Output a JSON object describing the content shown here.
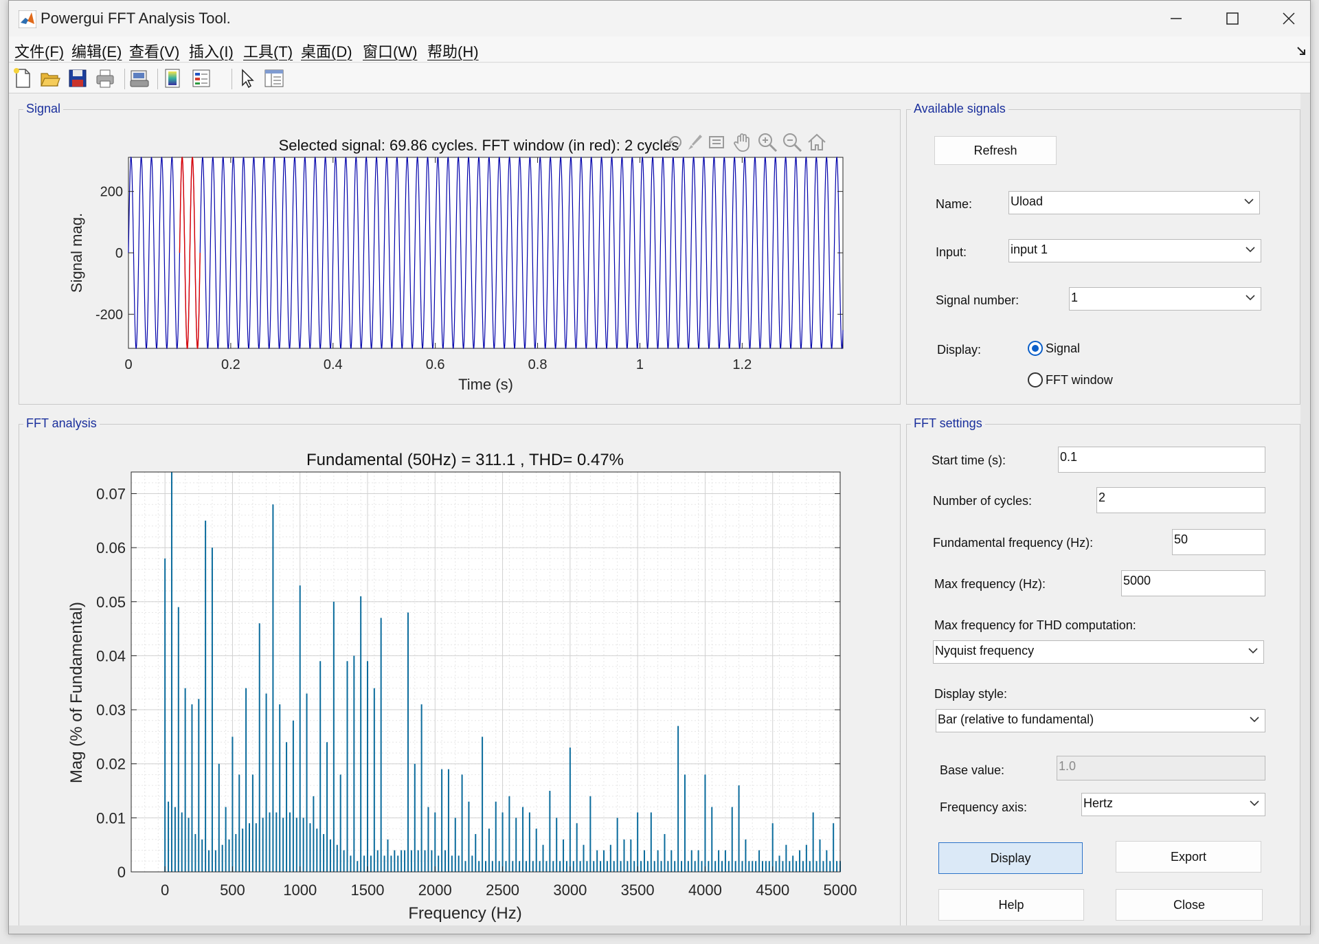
{
  "window": {
    "title": "Powergui FFT Analysis Tool."
  },
  "menu": [
    "文件(F)",
    "编辑(E)",
    "查看(V)",
    "插入(I)",
    "工具(T)",
    "桌面(D)",
    "窗口(W)",
    "帮助(H)"
  ],
  "toolbar_icons": [
    "new-file-icon",
    "open-folder-icon",
    "save-icon",
    "print-icon",
    "print-preview-icon",
    "colorbar-icon",
    "legend-icon",
    "select-pointer-icon",
    "property-inspector-icon"
  ],
  "signal_panel": {
    "title": "Signal",
    "axes_toolbar_icons": [
      "restore-view-icon",
      "data-tips-icon",
      "brush-icon",
      "pan-icon",
      "zoom-in-icon",
      "zoom-out-icon",
      "home-icon"
    ]
  },
  "fft_panel": {
    "title": "FFT analysis"
  },
  "available_signals": {
    "title": "Available signals",
    "refresh_label": "Refresh",
    "name_label": "Name:",
    "name_value": "Uload",
    "input_label": "Input:",
    "input_value": "input 1",
    "signal_number_label": "Signal number:",
    "signal_number_value": "1",
    "display_label": "Display:",
    "display_options": [
      "Signal",
      "FFT window"
    ],
    "display_selected": "Signal"
  },
  "fft_settings": {
    "title": "FFT settings",
    "start_time_label": "Start time (s):",
    "start_time_value": "0.1",
    "num_cycles_label": "Number of cycles:",
    "num_cycles_value": "2",
    "fund_freq_label": "Fundamental frequency (Hz):",
    "fund_freq_value": "50",
    "max_freq_label": "Max frequency (Hz):",
    "max_freq_value": "5000",
    "thd_label": "Max frequency for THD computation:",
    "thd_value": "Nyquist frequency",
    "display_style_label": "Display style:",
    "display_style_value": "Bar (relative to fundamental)",
    "base_value_label": "Base value:",
    "base_value_value": "1.0",
    "freq_axis_label": "Frequency axis:",
    "freq_axis_value": "Hertz",
    "buttons": {
      "display": "Display",
      "export": "Export",
      "help": "Help",
      "close": "Close"
    }
  },
  "colors": {
    "signal_line": "#0000aa",
    "fft_window_line": "#dd0000",
    "bar_color": "#0a6b9c",
    "panel_title": "#1a2f9c"
  },
  "chart_data": [
    {
      "type": "line",
      "title": "Selected signal: 69.86 cycles. FFT window (in red): 2 cycles",
      "xlabel": "Time (s)",
      "ylabel": "Signal mag.",
      "xlim": [
        0,
        1.397
      ],
      "ylim": [
        -311.1,
        311.1
      ],
      "xticks": [
        0,
        0.2,
        0.4,
        0.6,
        0.8,
        1,
        1.2
      ],
      "xtick_labels": [
        "0",
        "0.2",
        "0.4",
        "0.6",
        "0.8",
        "1",
        "1.2"
      ],
      "yticks": [
        200,
        0,
        -200
      ],
      "ytick_labels": [
        "200",
        "0",
        "-200"
      ],
      "frequency_hz": 50,
      "amplitude": 311.1,
      "fft_window": [
        0.1,
        0.14
      ],
      "grid": false
    },
    {
      "type": "bar",
      "title": "Fundamental (50Hz) = 311.1 , THD= 0.47%",
      "xlabel": "Frequency (Hz)",
      "ylabel": "Mag (% of Fundamental)",
      "xlim": [
        -250,
        5000
      ],
      "ylim": [
        0,
        0.074
      ],
      "xticks": [
        0,
        500,
        1000,
        1500,
        2000,
        2500,
        3000,
        3500,
        4000,
        4500,
        5000
      ],
      "xtick_labels": [
        "0",
        "500",
        "1000",
        "1500",
        "2000",
        "2500",
        "3000",
        "3500",
        "4000",
        "4500",
        "5000"
      ],
      "yticks": [
        0,
        0.01,
        0.02,
        0.03,
        0.04,
        0.05,
        0.06,
        0.07
      ],
      "ytick_labels": [
        "0",
        "0.01",
        "0.02",
        "0.03",
        "0.04",
        "0.05",
        "0.06",
        "0.07"
      ],
      "grid": true,
      "bar_width_hz": 8,
      "bars": [
        [
          0,
          0.058
        ],
        [
          25,
          0.013
        ],
        [
          50,
          0.074
        ],
        [
          75,
          0.012
        ],
        [
          100,
          0.049
        ],
        [
          125,
          0.011
        ],
        [
          150,
          0.034
        ],
        [
          175,
          0.01
        ],
        [
          200,
          0.031
        ],
        [
          225,
          0.007
        ],
        [
          250,
          0.032
        ],
        [
          275,
          0.006
        ],
        [
          300,
          0.065
        ],
        [
          325,
          0.004
        ],
        [
          350,
          0.06
        ],
        [
          375,
          0.004
        ],
        [
          400,
          0.02
        ],
        [
          425,
          0.005
        ],
        [
          450,
          0.012
        ],
        [
          475,
          0.006
        ],
        [
          500,
          0.025
        ],
        [
          525,
          0.007
        ],
        [
          550,
          0.018
        ],
        [
          575,
          0.008
        ],
        [
          600,
          0.034
        ],
        [
          625,
          0.009
        ],
        [
          650,
          0.018
        ],
        [
          675,
          0.009
        ],
        [
          700,
          0.046
        ],
        [
          725,
          0.01
        ],
        [
          750,
          0.033
        ],
        [
          775,
          0.011
        ],
        [
          800,
          0.068
        ],
        [
          825,
          0.011
        ],
        [
          850,
          0.031
        ],
        [
          875,
          0.01
        ],
        [
          900,
          0.024
        ],
        [
          925,
          0.011
        ],
        [
          950,
          0.028
        ],
        [
          975,
          0.01
        ],
        [
          1000,
          0.053
        ],
        [
          1025,
          0.01
        ],
        [
          1050,
          0.033
        ],
        [
          1075,
          0.009
        ],
        [
          1100,
          0.014
        ],
        [
          1125,
          0.008
        ],
        [
          1150,
          0.039
        ],
        [
          1175,
          0.007
        ],
        [
          1200,
          0.024
        ],
        [
          1225,
          0.006
        ],
        [
          1250,
          0.05
        ],
        [
          1275,
          0.005
        ],
        [
          1300,
          0.018
        ],
        [
          1325,
          0.004
        ],
        [
          1350,
          0.039
        ],
        [
          1375,
          0.003
        ],
        [
          1400,
          0.04
        ],
        [
          1425,
          0.002
        ],
        [
          1450,
          0.051
        ],
        [
          1475,
          0.003
        ],
        [
          1500,
          0.039
        ],
        [
          1525,
          0.003
        ],
        [
          1550,
          0.034
        ],
        [
          1575,
          0.004
        ],
        [
          1600,
          0.047
        ],
        [
          1625,
          0.003
        ],
        [
          1650,
          0.006
        ],
        [
          1675,
          0.003
        ],
        [
          1700,
          0.004
        ],
        [
          1725,
          0.003
        ],
        [
          1750,
          0.004
        ],
        [
          1775,
          0.004
        ],
        [
          1800,
          0.048
        ],
        [
          1825,
          0.004
        ],
        [
          1850,
          0.02
        ],
        [
          1875,
          0.004
        ],
        [
          1900,
          0.031
        ],
        [
          1925,
          0.004
        ],
        [
          1950,
          0.012
        ],
        [
          1975,
          0.004
        ],
        [
          2000,
          0.011
        ],
        [
          2025,
          0.003
        ],
        [
          2050,
          0.019
        ],
        [
          2075,
          0.004
        ],
        [
          2100,
          0.019
        ],
        [
          2125,
          0.003
        ],
        [
          2150,
          0.01
        ],
        [
          2175,
          0.003
        ],
        [
          2200,
          0.018
        ],
        [
          2225,
          0.002
        ],
        [
          2250,
          0.013
        ],
        [
          2275,
          0.003
        ],
        [
          2300,
          0.007
        ],
        [
          2325,
          0.002
        ],
        [
          2350,
          0.025
        ],
        [
          2375,
          0.002
        ],
        [
          2400,
          0.008
        ],
        [
          2425,
          0.002
        ],
        [
          2450,
          0.013
        ],
        [
          2475,
          0.002
        ],
        [
          2500,
          0.011
        ],
        [
          2525,
          0.002
        ],
        [
          2550,
          0.014
        ],
        [
          2575,
          0.002
        ],
        [
          2600,
          0.01
        ],
        [
          2625,
          0.002
        ],
        [
          2650,
          0.012
        ],
        [
          2675,
          0.002
        ],
        [
          2700,
          0.011
        ],
        [
          2725,
          0.002
        ],
        [
          2750,
          0.008
        ],
        [
          2775,
          0.002
        ],
        [
          2800,
          0.005
        ],
        [
          2825,
          0.002
        ],
        [
          2850,
          0.015
        ],
        [
          2875,
          0.002
        ],
        [
          2900,
          0.01
        ],
        [
          2925,
          0.002
        ],
        [
          2950,
          0.006
        ],
        [
          2975,
          0.002
        ],
        [
          3000,
          0.023
        ],
        [
          3025,
          0.002
        ],
        [
          3050,
          0.009
        ],
        [
          3075,
          0.002
        ],
        [
          3100,
          0.005
        ],
        [
          3125,
          0.002
        ],
        [
          3150,
          0.014
        ],
        [
          3175,
          0.002
        ],
        [
          3200,
          0.004
        ],
        [
          3225,
          0.002
        ],
        [
          3250,
          0.004
        ],
        [
          3275,
          0.002
        ],
        [
          3300,
          0.005
        ],
        [
          3325,
          0.002
        ],
        [
          3350,
          0.01
        ],
        [
          3375,
          0.002
        ],
        [
          3400,
          0.006
        ],
        [
          3425,
          0.002
        ],
        [
          3450,
          0.006
        ],
        [
          3475,
          0.002
        ],
        [
          3500,
          0.011
        ],
        [
          3525,
          0.002
        ],
        [
          3550,
          0.004
        ],
        [
          3575,
          0.002
        ],
        [
          3600,
          0.011
        ],
        [
          3625,
          0.002
        ],
        [
          3650,
          0.004
        ],
        [
          3675,
          0.002
        ],
        [
          3700,
          0.007
        ],
        [
          3725,
          0.002
        ],
        [
          3750,
          0.004
        ],
        [
          3775,
          0.002
        ],
        [
          3800,
          0.027
        ],
        [
          3825,
          0.002
        ],
        [
          3850,
          0.018
        ],
        [
          3875,
          0.002
        ],
        [
          3900,
          0.004
        ],
        [
          3925,
          0.002
        ],
        [
          3950,
          0.004
        ],
        [
          3975,
          0.002
        ],
        [
          4000,
          0.018
        ],
        [
          4025,
          0.002
        ],
        [
          4050,
          0.012
        ],
        [
          4075,
          0.002
        ],
        [
          4100,
          0.004
        ],
        [
          4125,
          0.002
        ],
        [
          4150,
          0.004
        ],
        [
          4175,
          0.002
        ],
        [
          4200,
          0.012
        ],
        [
          4225,
          0.002
        ],
        [
          4250,
          0.016
        ],
        [
          4275,
          0.002
        ],
        [
          4300,
          0.006
        ],
        [
          4325,
          0.002
        ],
        [
          4350,
          0.002
        ],
        [
          4375,
          0.002
        ],
        [
          4400,
          0.004
        ],
        [
          4425,
          0.002
        ],
        [
          4450,
          0.002
        ],
        [
          4475,
          0.002
        ],
        [
          4500,
          0.009
        ],
        [
          4525,
          0.002
        ],
        [
          4550,
          0.003
        ],
        [
          4575,
          0.002
        ],
        [
          4600,
          0.005
        ],
        [
          4625,
          0.002
        ],
        [
          4650,
          0.003
        ],
        [
          4675,
          0.002
        ],
        [
          4700,
          0.004
        ],
        [
          4725,
          0.002
        ],
        [
          4750,
          0.005
        ],
        [
          4775,
          0.002
        ],
        [
          4800,
          0.011
        ],
        [
          4825,
          0.002
        ],
        [
          4850,
          0.006
        ],
        [
          4875,
          0.002
        ],
        [
          4900,
          0.004
        ],
        [
          4925,
          0.002
        ],
        [
          4950,
          0.009
        ],
        [
          4975,
          0.002
        ],
        [
          5000,
          0.002
        ]
      ]
    }
  ]
}
